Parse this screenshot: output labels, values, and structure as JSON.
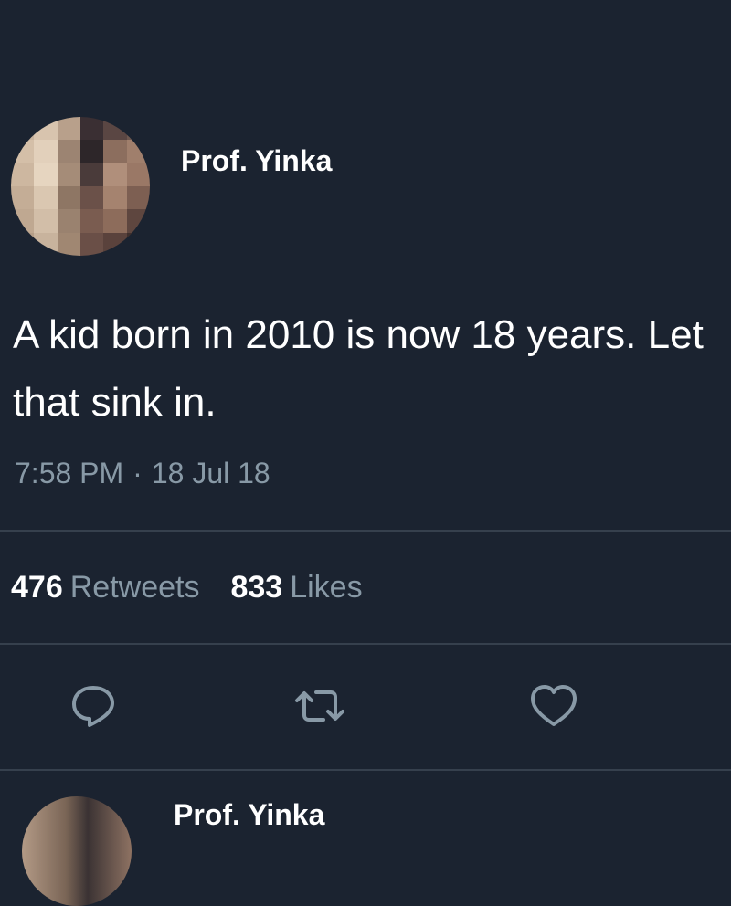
{
  "tweet": {
    "display_name": "Prof. Yinka",
    "text": "A kid born in 2010 is now 18 years. Let that sink in.",
    "time": "7:58 PM",
    "separator": "·",
    "date": "18 Jul 18",
    "retweets": {
      "count": "476",
      "label": "Retweets"
    },
    "likes": {
      "count": "833",
      "label": "Likes"
    }
  },
  "actions": {
    "reply_icon": "reply-icon",
    "retweet_icon": "retweet-icon",
    "like_icon": "heart-icon"
  },
  "next_tweet": {
    "display_name": "Prof. Yinka"
  },
  "colors": {
    "background": "#1b2330",
    "text": "#ffffff",
    "secondary_text": "#8899a6",
    "divider": "#36404d"
  }
}
